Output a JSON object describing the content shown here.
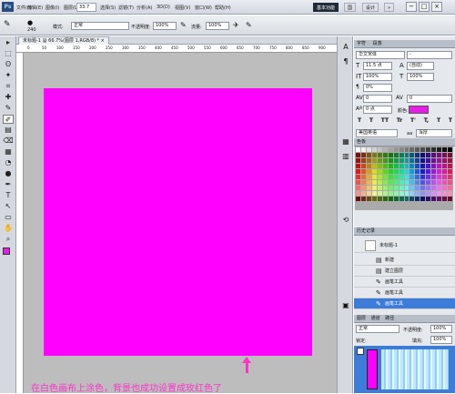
{
  "app": {
    "logo": "Ps",
    "zoom": "33.7"
  },
  "menu": [
    "文件(F)",
    "编辑(E)",
    "图像(I)",
    "图层(L)",
    "选择(S)",
    "滤镜(T)",
    "分析(A)",
    "3D(D)",
    "视图(V)",
    "窗口(W)",
    "帮助(H)"
  ],
  "workspace": {
    "basic": "基本功能",
    "active": "国",
    "design": "设计",
    "more": "»"
  },
  "window_buttons": [
    "−",
    "□",
    "×"
  ],
  "options": {
    "brush_size": "240",
    "mode_label": "模式:",
    "mode_value": "正常",
    "opacity_label": "不透明度:",
    "opacity_value": "100%",
    "flow_label": "流量:",
    "flow_value": "100%"
  },
  "document_tab": "未标题-1 @ 66.7%(图层 1,RGB/8) * ×",
  "ruler_ticks": [
    "0",
    "50",
    "100",
    "150",
    "200",
    "250",
    "300",
    "350",
    "400",
    "450",
    "500",
    "550",
    "600",
    "650",
    "700",
    "750",
    "800",
    "850",
    "900"
  ],
  "annotation": "在白色画布上涂色，背景也成功设置成玫红色了",
  "character_panel": {
    "tabs": [
      "字符",
      "段落"
    ],
    "font_family": "华文宋体",
    "font_style": "-",
    "font_size": "11.5 点",
    "leading": "(自动)",
    "vscale": "100%",
    "hscale": "100%",
    "baseline": "0%",
    "tracking": "0",
    "kerning": "0",
    "shift": "0 点",
    "color_label": "颜色:",
    "styles": [
      "T",
      "T",
      "TT",
      "Tr",
      "T'",
      "T,",
      "T",
      "T"
    ],
    "language": "美国英语",
    "aa_label": "aa",
    "aa_value": "浑厚",
    "color": "#e61ee6"
  },
  "swatches_panel": {
    "title": "色板"
  },
  "history_panel": {
    "title": "历史记录",
    "snapshot": "未标题-1",
    "items": [
      {
        "label": "新建",
        "icon": "▤"
      },
      {
        "label": "建立图层",
        "icon": "▤"
      },
      {
        "label": "画笔工具",
        "icon": "✎"
      },
      {
        "label": "画笔工具",
        "icon": "✎"
      },
      {
        "label": "画笔工具",
        "icon": "✎"
      }
    ]
  },
  "layers_panel": {
    "tabs": [
      "图层",
      "通道",
      "路径"
    ],
    "mode": "正常",
    "opacity_label": "不透明度:",
    "opacity": "100%",
    "lock_label": "锁定:",
    "fill_label": "填充:",
    "fill": "100%"
  },
  "toolbar_icons": [
    "▸",
    "⬚",
    "ʘ",
    "✦",
    "⌗",
    "✚",
    "✎",
    "✐",
    "▤",
    "⌫",
    "▦",
    "◔",
    "●",
    "✒",
    "T",
    "↖",
    "▭",
    "✋",
    "⌕"
  ],
  "dock_icons": [
    "A",
    "¶",
    "▦",
    "▥",
    "⟲",
    "▣"
  ]
}
